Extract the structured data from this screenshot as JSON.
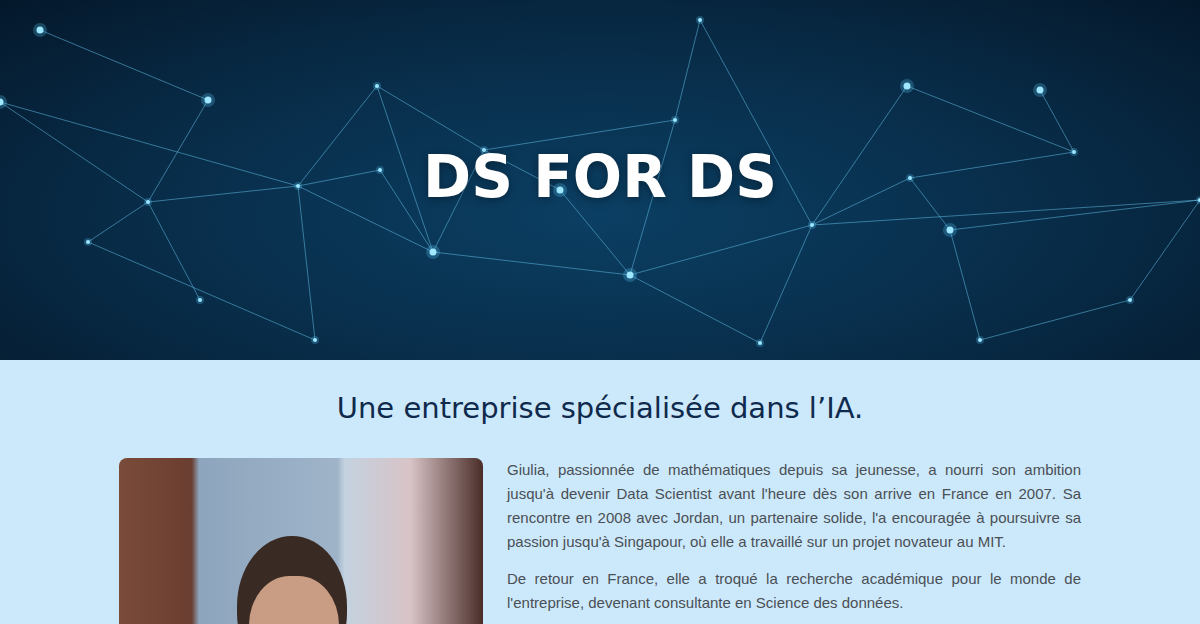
{
  "hero": {
    "title": "DS FOR DS"
  },
  "section": {
    "heading": "Une entreprise spécialisée dans l’IA.",
    "paragraphs": [
      "Giulia, passionnée de mathématiques depuis sa jeunesse, a nourri son ambition jusqu'à devenir Data Scientist avant l'heure dès son arrive en France en 2007. Sa rencontre en 2008 avec Jordan, un partenaire solide, l'a encouragée à poursuivre sa passion jusqu'à Singapour, où elle a travaillé sur un projet novateur au MIT.",
      "De retour en France, elle a troqué la recherche académique pour le monde de l'entreprise, devenant consultante en Science des données."
    ]
  }
}
